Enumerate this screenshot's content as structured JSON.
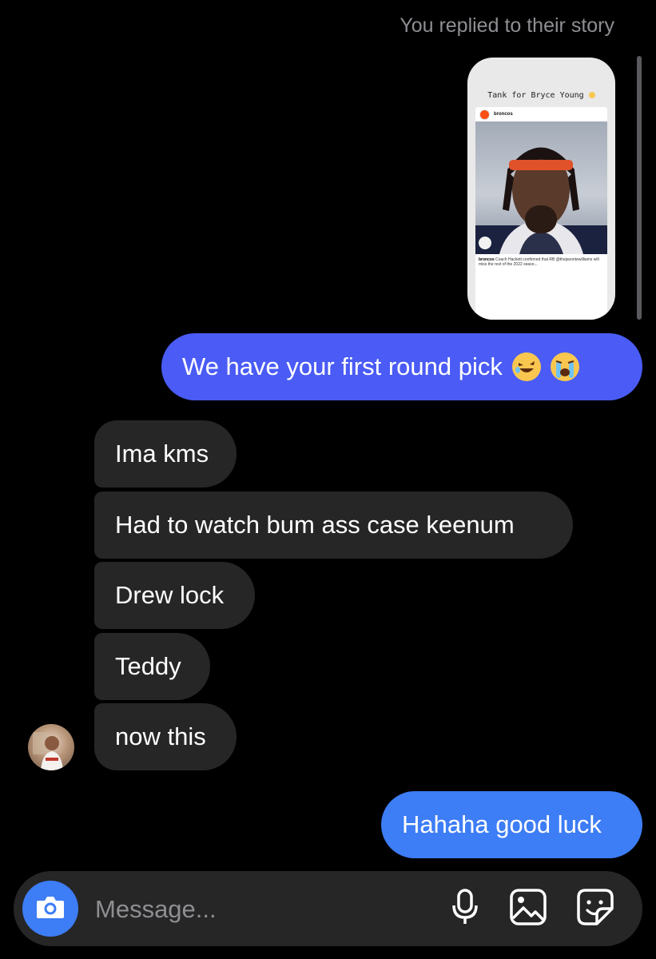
{
  "header": {
    "story_reply_note": "You replied to their story"
  },
  "story": {
    "caption": "Tank for Bryce Young",
    "post_account": "broncos",
    "post_caption_account": "broncos",
    "post_caption_text": "Coach Hackett confirmed that RB @thejavontewilliams will miss the rest of the 2022 seaso..."
  },
  "messages": [
    {
      "direction": "sent",
      "text": "We have your first round pick",
      "emojis": [
        "rolling-on-floor-laughing",
        "loudly-crying"
      ]
    },
    {
      "direction": "received",
      "text": "Ima kms"
    },
    {
      "direction": "received",
      "text": "Had to watch bum ass case keenum"
    },
    {
      "direction": "received",
      "text": "Drew lock"
    },
    {
      "direction": "received",
      "text": "Teddy"
    },
    {
      "direction": "received",
      "text": "now this"
    },
    {
      "direction": "sent",
      "text": "Hahaha good luck"
    }
  ],
  "composer": {
    "placeholder": "Message..."
  },
  "icons": {
    "camera": "camera-icon",
    "mic": "microphone-icon",
    "gallery": "gallery-icon",
    "sticker": "sticker-icon"
  },
  "colors": {
    "sent_bubble_1": "#4a5cf5",
    "sent_bubble_2": "#3d7df5",
    "received_bubble": "#262626",
    "background": "#000000",
    "camera_button": "#3d7df5"
  }
}
